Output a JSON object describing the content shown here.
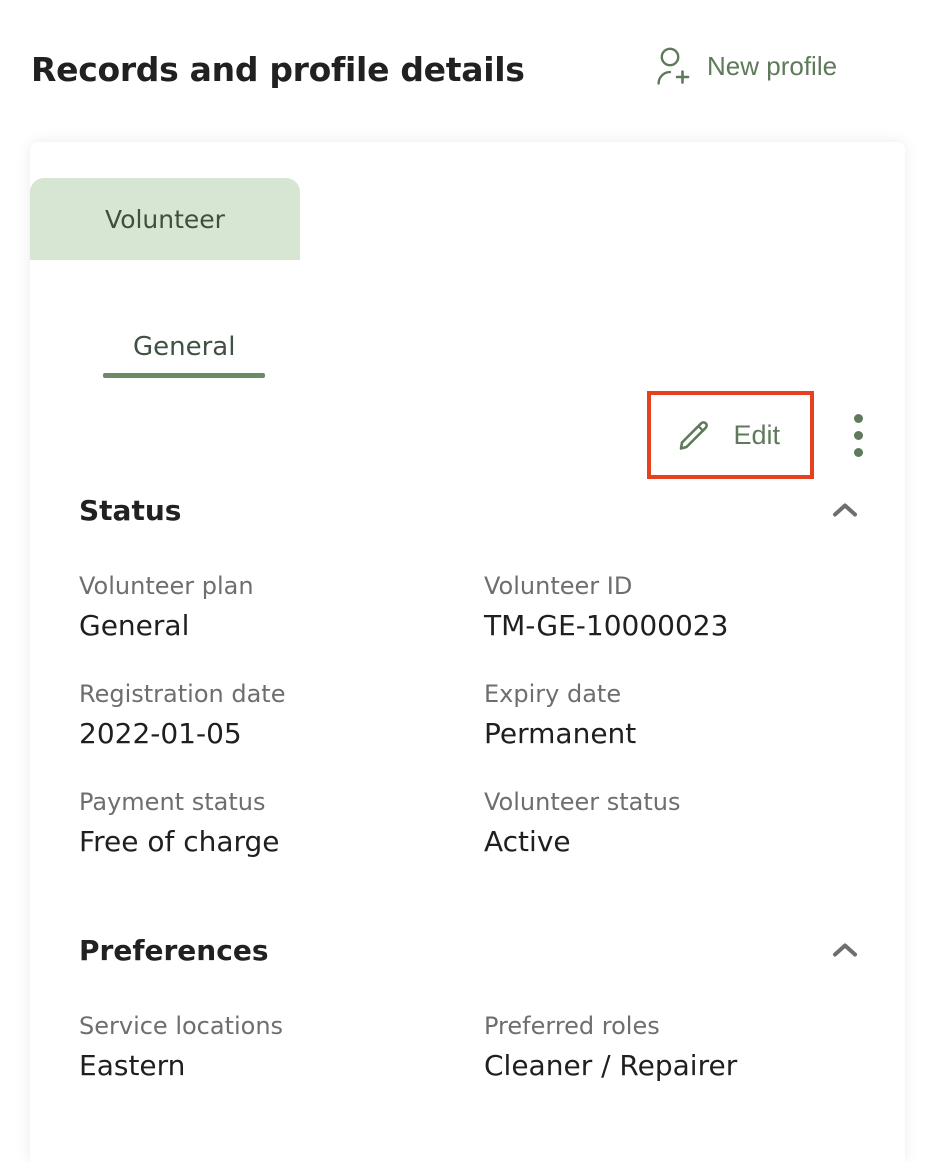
{
  "header": {
    "title": "Records and profile details",
    "new_profile_label": "New profile",
    "new_profile_icon": "user-plus-icon"
  },
  "colors": {
    "accent_green": "#5f7a5b",
    "tab_green_bg": "#d7e6d3",
    "tab_underline": "#6d8a66",
    "highlight_red": "#e8401f",
    "title_dark": "#212121",
    "label_gray": "#6e6e6e"
  },
  "record_tabs": [
    {
      "label": "Volunteer",
      "active": true
    }
  ],
  "section_tabs": [
    {
      "label": "General",
      "active": true
    }
  ],
  "actions": {
    "edit_label": "Edit",
    "edit_icon": "pencil-icon",
    "more_icon": "kebab-menu-icon",
    "edit_highlighted": true
  },
  "sections": [
    {
      "title": "Status",
      "collapse_icon": "chevron-up-icon",
      "expanded": true,
      "fields": [
        {
          "label": "Volunteer plan",
          "value": "General"
        },
        {
          "label": "Volunteer ID",
          "value": "TM-GE-10000023"
        },
        {
          "label": "Registration date",
          "value": "2022-01-05"
        },
        {
          "label": "Expiry date",
          "value": "Permanent"
        },
        {
          "label": "Payment status",
          "value": "Free of charge"
        },
        {
          "label": "Volunteer status",
          "value": "Active"
        }
      ]
    },
    {
      "title": "Preferences",
      "collapse_icon": "chevron-up-icon",
      "expanded": true,
      "fields": [
        {
          "label": "Service locations",
          "value": "Eastern"
        },
        {
          "label": "Preferred roles",
          "value": "Cleaner / Repairer"
        }
      ]
    }
  ]
}
